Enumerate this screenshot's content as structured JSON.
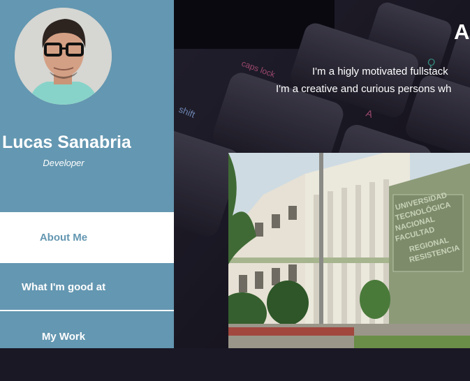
{
  "profile": {
    "name": "Lucas Sanabria",
    "role": "Developer"
  },
  "nav": {
    "items": [
      {
        "label": "About Me",
        "active": true
      },
      {
        "label": "What I'm good at",
        "active": false
      },
      {
        "label": "My Work",
        "active": false
      }
    ]
  },
  "hero": {
    "title": "A",
    "line1": "I'm a higly motivated fullstack",
    "line2": "I'm a creative and curious persons wh",
    "keycaps": [
      "caps lock",
      "shift",
      "A",
      "Q"
    ]
  },
  "colors": {
    "sidebar": "#6497b1",
    "active_nav_bg": "#ffffff"
  }
}
